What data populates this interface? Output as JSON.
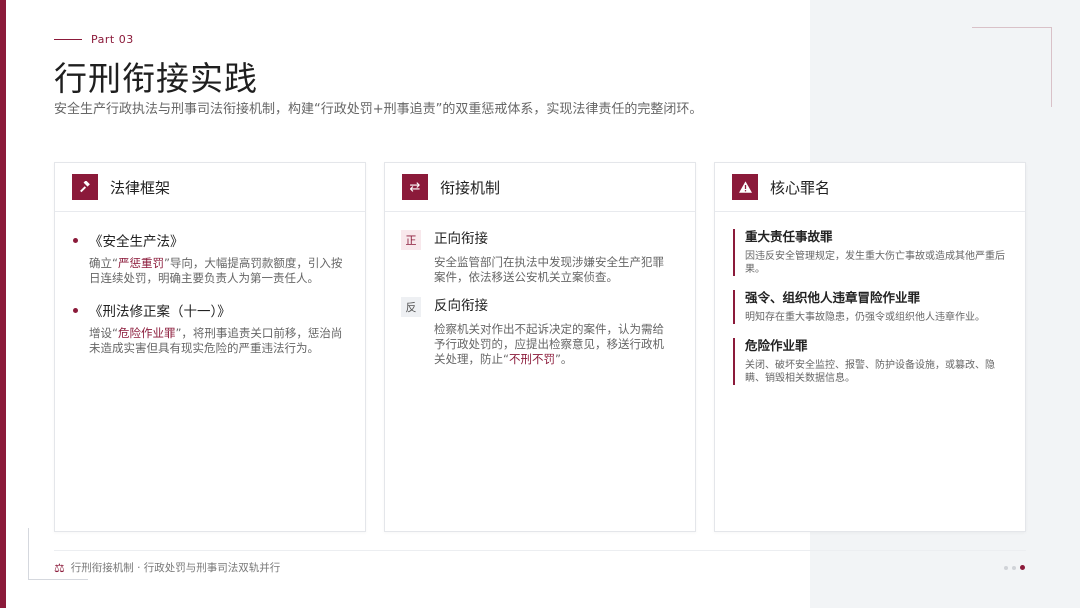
{
  "header": {
    "part_label": "Part 03",
    "title": "行刑衔接实践",
    "subtitle": "安全生产行政执法与刑事司法衔接机制，构建“行政处罚+刑事追责”的双重惩戒体系，实现法律责任的完整闭环。"
  },
  "cards": [
    {
      "title": "法律框架",
      "icon": "gavel-icon",
      "items": [
        {
          "title": "《安全生产法》",
          "desc_before": "确立“",
          "highlight": "严惩重罚",
          "desc_after": "”导向，大幅提高罚款额度，引入按日连续处罚，明确主要负责人为第一责任人。"
        },
        {
          "title": "《刑法修正案（十一）》",
          "desc_before": "增设“",
          "highlight": "危险作业罪",
          "desc_after": "”，将刑事追责关口前移，惩治尚未造成实害但具有现实危险的严重违法行为。"
        }
      ]
    },
    {
      "title": "衔接机制",
      "icon": "exchange-arrows-icon",
      "items": [
        {
          "badge": "正",
          "title": "正向衔接",
          "desc_before": "安全监管部门在执法中发现涉嫌安全生产犯罪案件，依法移送公安机关立案侦查。",
          "highlight": "",
          "desc_after": ""
        },
        {
          "badge": "反",
          "title": "反向衔接",
          "desc_before": "检察机关对作出不起诉决定的案件，认为需给予行政处罚的，应提出检察意见，移送行政机关处理，防止“",
          "highlight": "不刑不罚",
          "desc_after": "”。"
        }
      ]
    },
    {
      "title": "核心罪名",
      "icon": "warning-icon",
      "items": [
        {
          "title": "重大责任事故罪",
          "desc": "因违反安全管理规定，发生重大伤亡事故或造成其他严重后果。"
        },
        {
          "title": "强令、组织他人违章冒险作业罪",
          "desc": "明知存在重大事故隐患，仍强令或组织他人违章作业。"
        },
        {
          "title": "危险作业罪",
          "desc": "关闭、破坏安全监控、报警、防护设备设施，或篡改、隐瞒、销毁相关数据信息。"
        }
      ]
    }
  ],
  "footer": {
    "icon": "scales-icon",
    "text": "行刑衔接机制 · 行政处罚与刑事司法双轨并行"
  },
  "pagination": {
    "total": 3,
    "current": 3
  },
  "colors": {
    "accent": "#8b1a3a",
    "panel": "#f2f4f6"
  }
}
